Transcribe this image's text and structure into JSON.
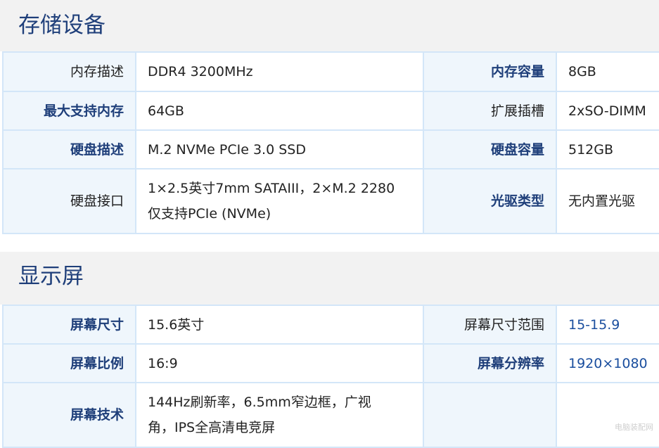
{
  "storage": {
    "title": "存储设备",
    "rows": [
      {
        "label1": "内存描述",
        "value1": "DDR4 3200MHz",
        "label2": "内存容量",
        "value2": "8GB"
      },
      {
        "label1": "最大支持内存",
        "value1": "64GB",
        "label2": "扩展插槽",
        "value2": "2xSO-DIMM"
      },
      {
        "label1": "硬盘描述",
        "value1": "M.2 NVMe PCIe 3.0 SSD",
        "label2": "硬盘容量",
        "value2": "512GB"
      },
      {
        "label1": "硬盘接口",
        "value1_line1": "1×2.5英寸7mm SATAIII，2×M.2 2280",
        "value1_line2": "仅支持PCIe (NVMe)",
        "label2": "光驱类型",
        "value2": "无内置光驱"
      }
    ]
  },
  "display": {
    "title": "显示屏",
    "rows": [
      {
        "label1": "屏幕尺寸",
        "value1": "15.6英寸",
        "label2": "屏幕尺寸范围",
        "value2": "15-15.9"
      },
      {
        "label1": "屏幕比例",
        "value1": "16:9",
        "label2": "屏幕分辨率",
        "value2": "1920×1080"
      },
      {
        "label1": "屏幕技术",
        "value1_line1": "144Hz刷新率，6.5mm窄边框，广视",
        "value1_line2": "角，IPS全高清电竞屏",
        "label2": "",
        "value2": ""
      }
    ]
  },
  "watermark": "电脑装配网"
}
